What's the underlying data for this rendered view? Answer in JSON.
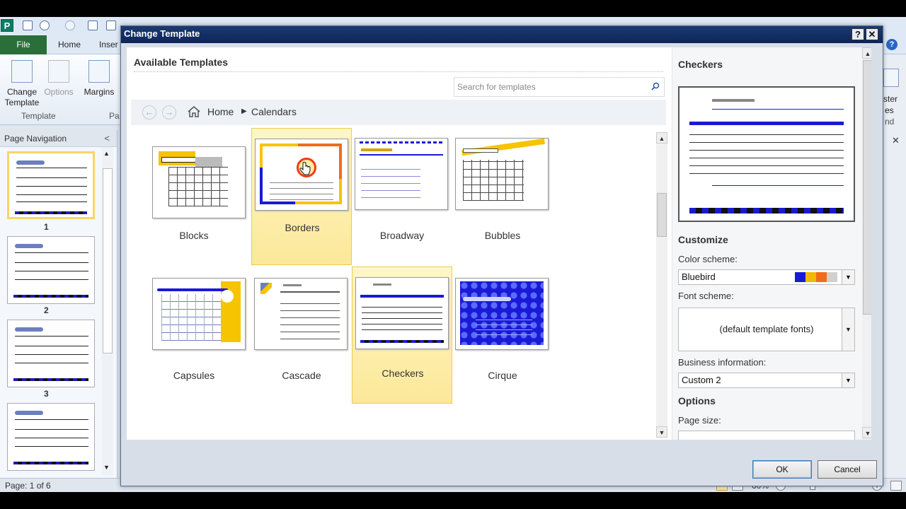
{
  "app": {
    "qat_letter": "P",
    "tabs": {
      "file": "File",
      "home": "Home",
      "insert": "Inser"
    },
    "ribbon": {
      "change_template": "Change\nTemplate",
      "change_template_l1": "Change",
      "change_template_l2": "Template",
      "options": "Options",
      "margins": "Margins",
      "group_template": "Template",
      "group_pa": "Pa",
      "right_partial_1": "ster",
      "right_partial_2": "es",
      "right_partial_3": "nd"
    },
    "nav": {
      "title": "Page Navigation",
      "pages": [
        "1",
        "2",
        "3"
      ]
    },
    "status": {
      "page": "Page: 1 of 6",
      "zoom": "60%"
    }
  },
  "dialog": {
    "title": "Change Template",
    "available": "Available Templates",
    "search_placeholder": "Search for templates",
    "breadcrumb": {
      "home": "Home",
      "current": "Calendars"
    },
    "templates": [
      "Blocks",
      "Borders",
      "Broadway",
      "Bubbles",
      "Capsules",
      "Cascade",
      "Checkers",
      "Cirque"
    ],
    "preview_title": "Checkers",
    "customize": "Customize",
    "color_scheme_label": "Color scheme:",
    "color_scheme_value": "Bluebird",
    "color_swatches": [
      "#1a1ad6",
      "#f5b800",
      "#ef6c1a",
      "#d0d0d0"
    ],
    "font_scheme_label": "Font scheme:",
    "font_scheme_value": "(default template fonts)",
    "business_label": "Business information:",
    "business_value": "Custom 2",
    "options": "Options",
    "page_size_label": "Page size:",
    "ok": "OK",
    "cancel": "Cancel"
  }
}
